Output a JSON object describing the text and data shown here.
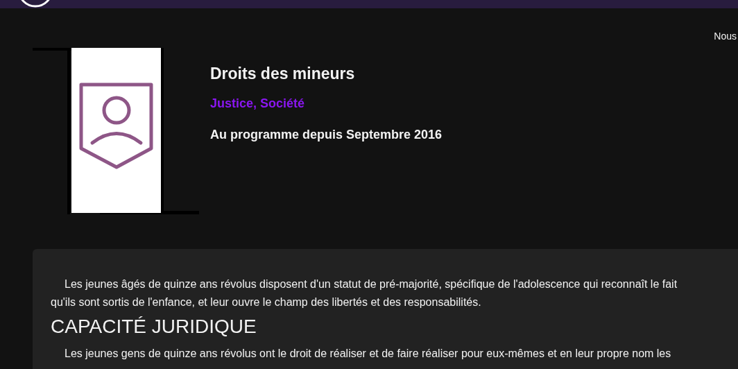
{
  "header": {
    "nav_text": "Nous"
  },
  "topic": {
    "title": "Droits des mineurs",
    "categories": "Justice, Société",
    "since": "Au programme depuis Septembre 2016"
  },
  "article": [
    {
      "kind": "paragraph",
      "text": "Les jeunes âgés de quinze ans révolus disposent d'un statut de pré-majorité, spécifique de l'adolescence qui reconnaît le fait qu'ils sont sortis de l'enfance, et leur ouvre le champ des libertés et des responsabilités."
    },
    {
      "kind": "heading",
      "text": "CAPACITÉ JURIDIQUE"
    },
    {
      "kind": "paragraph_cut",
      "text": "Les jeunes gens de quinze ans révolus ont le droit de réaliser et de faire réaliser pour eux-mêmes et en leur propre nom les"
    }
  ]
}
